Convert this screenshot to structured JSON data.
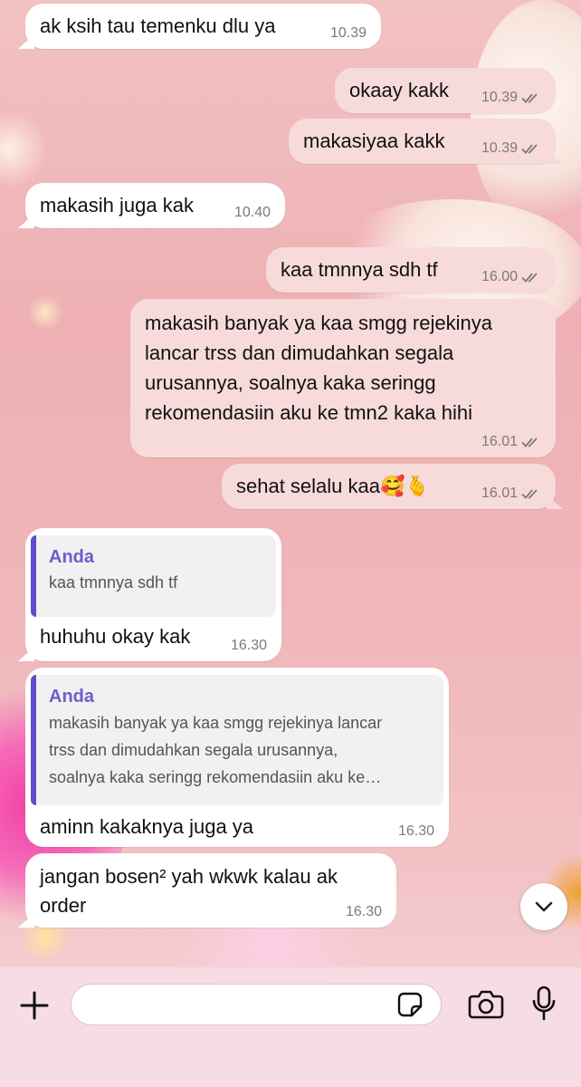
{
  "messages": [
    {
      "dir": "in",
      "text": "ak ksih tau temenku dlu ya",
      "time": "10.39"
    },
    {
      "dir": "out",
      "text": "okaay kakk",
      "time": "10.39",
      "status": "read"
    },
    {
      "dir": "out",
      "text": "makasiyaa kakk",
      "time": "10.39",
      "status": "read"
    },
    {
      "dir": "in",
      "text": "makasih juga kak",
      "time": "10.40"
    },
    {
      "dir": "out",
      "text": "kaa tmnnya sdh tf",
      "time": "16.00",
      "status": "read"
    },
    {
      "dir": "out",
      "text": "makasih banyak ya kaa smgg rejekinya\nlancar trss dan dimudahkan segala\nurusannya, soalnya kaka seringg\nrekomendasiin aku ke tmn2 kaka hihi",
      "time": "16.01",
      "status": "read"
    },
    {
      "dir": "out",
      "text": "sehat selalu kaa🥰🫰",
      "time": "16.01",
      "status": "read"
    },
    {
      "dir": "in",
      "quote_author": "Anda",
      "quote_text": "kaa tmnnya sdh tf",
      "text": "huhuhu okay kak",
      "time": "16.30"
    },
    {
      "dir": "in",
      "quote_author": "Anda",
      "quote_text": "makasih banyak ya kaa smgg rejekinya lancar\ntrss dan dimudahkan segala urusannya,\nsoalnya kaka seringg rekomendasiin aku ke…",
      "text": "aminn kakaknya juga ya",
      "time": "16.30"
    },
    {
      "dir": "in",
      "text": "jangan bosen² yah wkwk kalau ak\norder",
      "time": "16.30"
    }
  ],
  "composer": {
    "placeholder": ""
  },
  "colors": {
    "incoming": "#ffffff",
    "outgoing": "#f7dada",
    "quote_bar": "#5b4fc9",
    "quote_author": "#6a5ec8"
  },
  "icons": {
    "plus": "plus-icon",
    "sticker": "sticker-icon",
    "camera": "camera-icon",
    "mic": "microphone-icon",
    "scroll": "chevron-down-icon",
    "read": "double-check-icon"
  }
}
